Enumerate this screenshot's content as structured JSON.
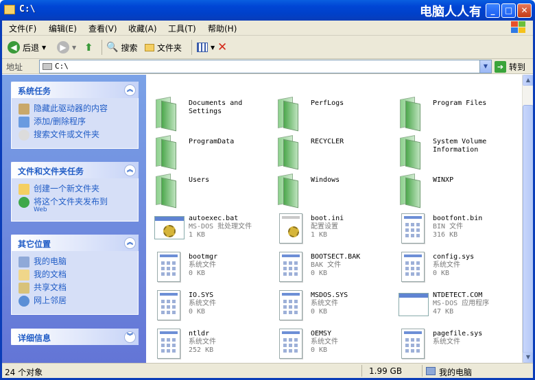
{
  "window": {
    "title": "C:\\",
    "brand": "电脑人人有",
    "min": "_",
    "max": "□",
    "close": "✕"
  },
  "menu": [
    "文件(F)",
    "编辑(E)",
    "查看(V)",
    "收藏(A)",
    "工具(T)",
    "帮助(H)"
  ],
  "toolbar": {
    "back": "后退",
    "search": "搜索",
    "folders": "文件夹"
  },
  "address": {
    "label": "地址",
    "value": "C:\\",
    "go": "转到"
  },
  "left": {
    "system_tasks": {
      "title": "系统任务",
      "items": [
        "隐藏此驱动器的内容",
        "添加/删除程序",
        "搜索文件或文件夹"
      ]
    },
    "file_tasks": {
      "title": "文件和文件夹任务",
      "items": [
        "创建一个新文件夹"
      ],
      "publish": "将这个文件夹发布到",
      "publish_sub": "Web"
    },
    "other_places": {
      "title": "其它位置",
      "items": [
        "我的电脑",
        "我的文档",
        "共享文档",
        "网上邻居"
      ]
    },
    "details": {
      "title": "详细信息"
    }
  },
  "files": [
    {
      "name": "Documents and Settings",
      "type": "",
      "size": "",
      "kind": "folder"
    },
    {
      "name": "PerfLogs",
      "type": "",
      "size": "",
      "kind": "folder"
    },
    {
      "name": "Program Files",
      "type": "",
      "size": "",
      "kind": "folder"
    },
    {
      "name": "ProgramData",
      "type": "",
      "size": "",
      "kind": "folder"
    },
    {
      "name": "RECYCLER",
      "type": "",
      "size": "",
      "kind": "folder"
    },
    {
      "name": "System Volume Information",
      "type": "",
      "size": "",
      "kind": "folder"
    },
    {
      "name": "Users",
      "type": "",
      "size": "",
      "kind": "folder"
    },
    {
      "name": "Windows",
      "type": "",
      "size": "",
      "kind": "folder"
    },
    {
      "name": "WINXP",
      "type": "",
      "size": "",
      "kind": "folder"
    },
    {
      "name": "autoexec.bat",
      "type": "MS-DOS 批处理文件",
      "size": "1 KB",
      "kind": "app"
    },
    {
      "name": "boot.ini",
      "type": "配置设置",
      "size": "1 KB",
      "kind": "ini"
    },
    {
      "name": "bootfont.bin",
      "type": "BIN 文件",
      "size": "316 KB",
      "kind": "doc"
    },
    {
      "name": "bootmgr",
      "type": "系统文件",
      "size": "0 KB",
      "kind": "doc"
    },
    {
      "name": "BOOTSECT.BAK",
      "type": "BAK 文件",
      "size": "0 KB",
      "kind": "doc"
    },
    {
      "name": "config.sys",
      "type": "系统文件",
      "size": "0 KB",
      "kind": "doc"
    },
    {
      "name": "IO.SYS",
      "type": "系统文件",
      "size": "0 KB",
      "kind": "doc"
    },
    {
      "name": "MSDOS.SYS",
      "type": "系统文件",
      "size": "0 KB",
      "kind": "doc"
    },
    {
      "name": "NTDETECT.COM",
      "type": "MS-DOS 应用程序",
      "size": "47 KB",
      "kind": "app"
    },
    {
      "name": "ntldr",
      "type": "系统文件",
      "size": "252 KB",
      "kind": "doc"
    },
    {
      "name": "OEMSY",
      "type": "系统文件",
      "size": "0 KB",
      "kind": "doc"
    },
    {
      "name": "pagefile.sys",
      "type": "系统文件",
      "size": "",
      "kind": "doc"
    }
  ],
  "status": {
    "count": "24 个对象",
    "size": "1.99 GB",
    "location": "我的电脑"
  }
}
